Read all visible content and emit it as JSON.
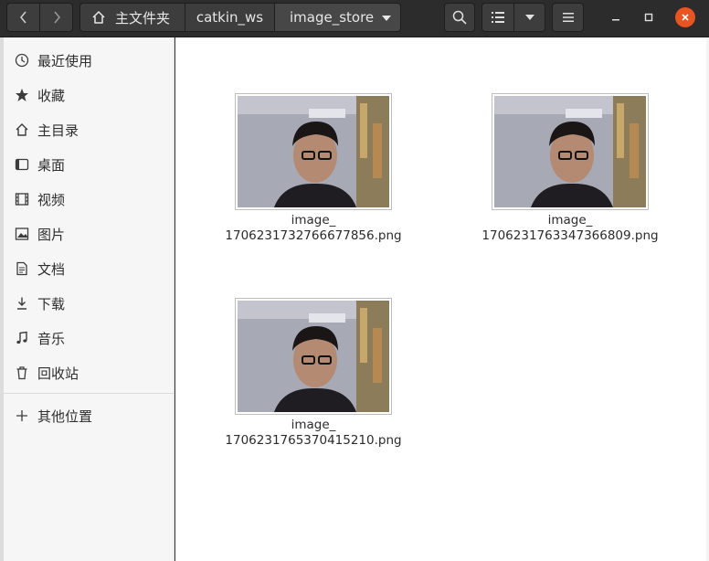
{
  "header": {
    "breadcrumbs": [
      "主文件夹",
      "catkin_ws",
      "image_store"
    ]
  },
  "sidebar": {
    "items": [
      {
        "label": "最近使用",
        "icon": "clock-icon"
      },
      {
        "label": "收藏",
        "icon": "star-icon"
      },
      {
        "label": "主目录",
        "icon": "home-icon"
      },
      {
        "label": "桌面",
        "icon": "desktop-icon"
      },
      {
        "label": "视频",
        "icon": "video-icon"
      },
      {
        "label": "图片",
        "icon": "picture-icon"
      },
      {
        "label": "文档",
        "icon": "document-icon"
      },
      {
        "label": "下载",
        "icon": "download-icon"
      },
      {
        "label": "音乐",
        "icon": "music-icon"
      },
      {
        "label": "回收站",
        "icon": "trash-icon"
      }
    ],
    "other_locations": {
      "label": "其他位置",
      "icon": "plus-icon"
    }
  },
  "files": [
    {
      "name_line1": "image_",
      "name_line2": "1706231732766677856.png"
    },
    {
      "name_line1": "image_",
      "name_line2": "1706231763347366809.png"
    },
    {
      "name_line1": "image_",
      "name_line2": "1706231765370415210.png"
    }
  ],
  "colors": {
    "accent_close": "#e95420",
    "headerbar": "#2c2c2c",
    "sidebar": "#f6f6f6"
  }
}
